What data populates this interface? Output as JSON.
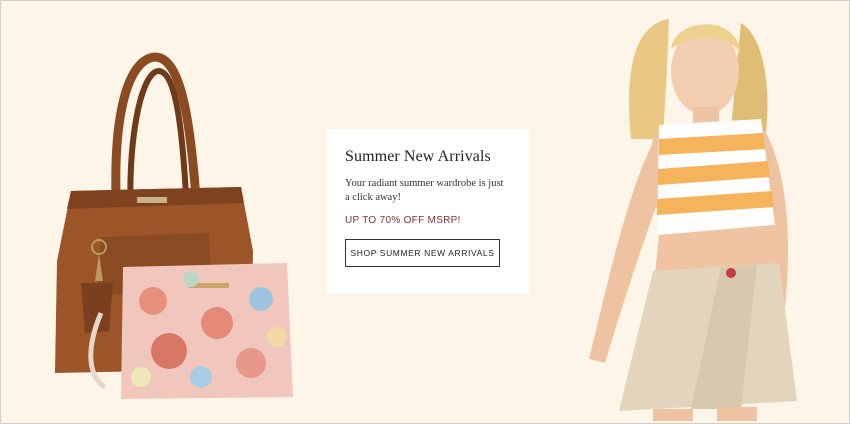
{
  "promo_banner": {
    "title": "Summer New Arrivals",
    "description": "Your radiant summer wardrobe is just a click away!",
    "promo": "UP TO 70% OFF MSRP!",
    "cta_label": "SHOP SUMMER NEW ARRIVALS"
  },
  "colors": {
    "background": "#fdf5e8",
    "card": "#ffffff",
    "promo_text": "#8b2d2d"
  }
}
